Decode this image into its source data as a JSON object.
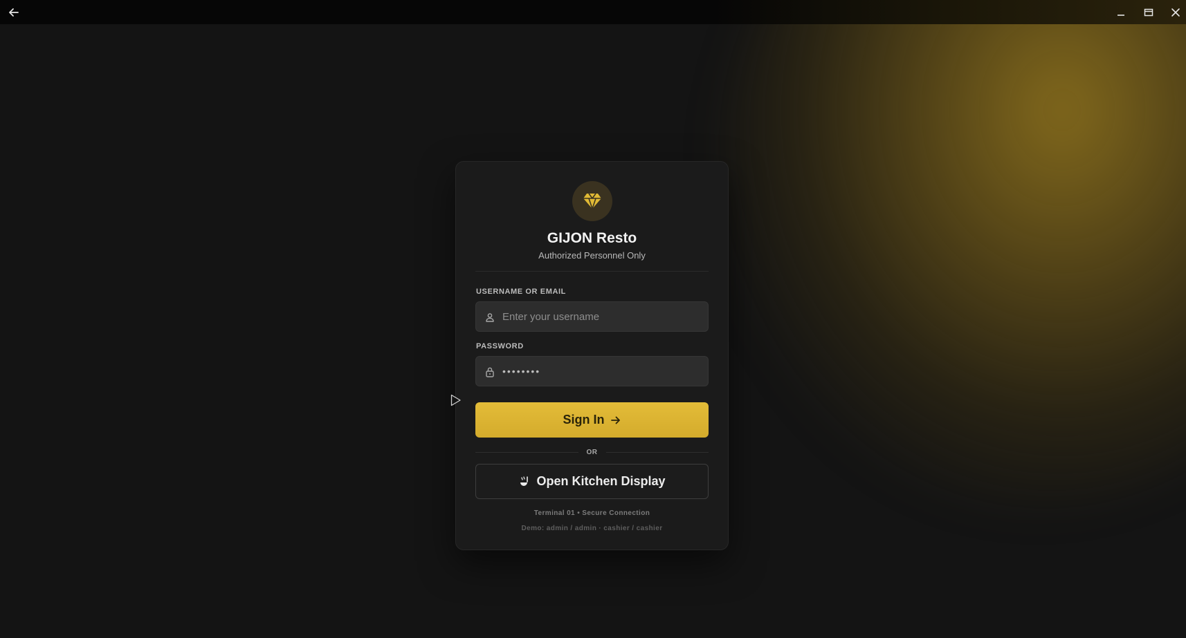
{
  "window": {
    "back_icon": "arrow-left-icon",
    "minimize_icon": "minimize-icon",
    "maximize_icon": "maximize-icon",
    "close_icon": "close-icon"
  },
  "brand": {
    "logo_icon": "diamond-icon",
    "title": "GIJON Resto",
    "subtitle": "Authorized Personnel Only",
    "accent_color": "#e0b935"
  },
  "form": {
    "username_label": "USERNAME OR EMAIL",
    "username_placeholder": "Enter your username",
    "username_value": "",
    "username_icon": "user-icon",
    "password_label": "PASSWORD",
    "password_value": "••••••••",
    "password_icon": "lock-icon",
    "signin_label": "Sign In",
    "signin_icon": "arrow-right-icon",
    "or_label": "OR",
    "kitchen_label": "Open Kitchen Display",
    "kitchen_icon": "ladle-icon"
  },
  "footer": {
    "terminal": "Terminal 01 • Secure Connection",
    "demo": "Demo: admin / admin · cashier / cashier"
  }
}
